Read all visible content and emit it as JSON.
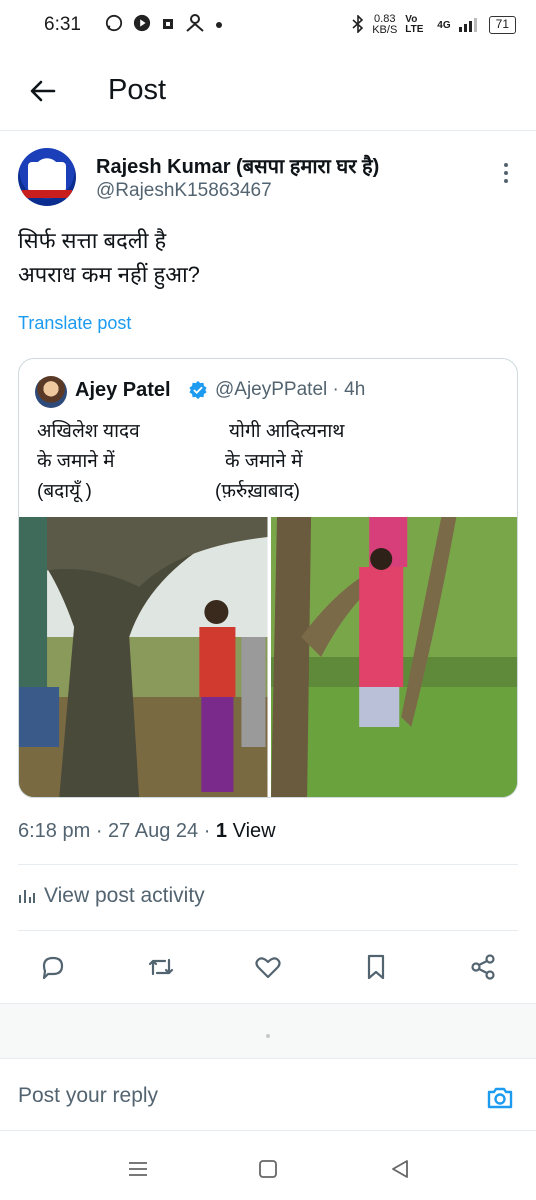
{
  "status_bar": {
    "time": "6:31",
    "net_speed_value": "0.83",
    "net_speed_unit": "KB/S",
    "volte": "Vo LTE",
    "network": "4G",
    "battery": "71"
  },
  "header": {
    "title": "Post"
  },
  "post": {
    "author_name": "Rajesh Kumar (बसपा हमारा घर है)",
    "author_handle": "@RajeshK15863467",
    "text_line1": "सिर्फ सत्ता बदली है",
    "text_line2": "अपराध कम नहीं हुआ?",
    "translate_label": "Translate post",
    "time": "6:18 pm",
    "date": "27 Aug 24",
    "views_count": "1",
    "views_label": "View"
  },
  "quote": {
    "author_name": "Ajey Patel",
    "author_handle": "@AjeyPPatel",
    "age": "4h",
    "left_line1": "अखिलेश यादव",
    "left_line2": "के जमाने में",
    "left_line3": "(बदायूँ )",
    "right_line1": "योगी आदित्यनाथ",
    "right_line2": "के जमाने में",
    "right_line3": "(फ़र्रुख़ाबाद)"
  },
  "activity_label": "View post activity",
  "reply": {
    "placeholder": "Post your reply"
  },
  "colors": {
    "accent": "#1d9bf0",
    "text": "#0f1419",
    "muted": "#536471"
  },
  "icons": {
    "actions": [
      "reply-icon",
      "repost-icon",
      "like-icon",
      "bookmark-icon",
      "share-icon"
    ],
    "nav": [
      "recent-apps-icon",
      "home-icon",
      "back-nav-icon"
    ]
  }
}
